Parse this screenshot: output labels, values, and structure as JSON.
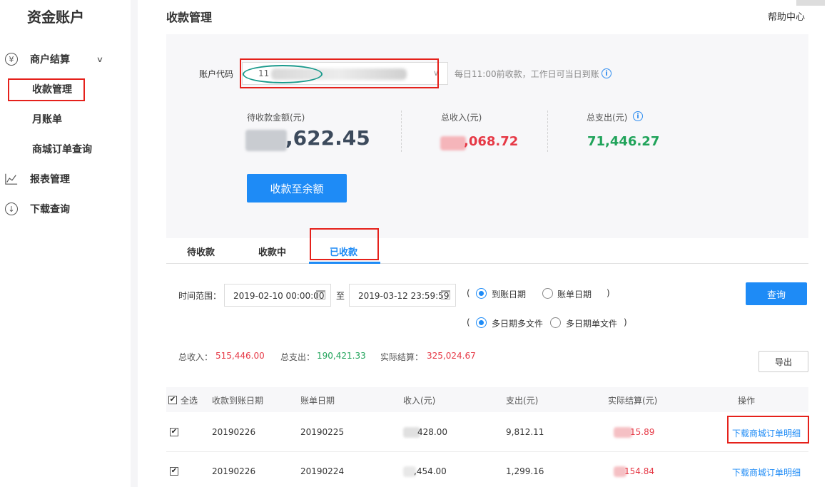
{
  "sidebar": {
    "brand": "资金账户",
    "groups": [
      {
        "label": "商户结算",
        "icon": "yen-circle-icon"
      },
      {
        "label": "报表管理",
        "icon": "chart-icon"
      },
      {
        "label": "下载查询",
        "icon": "download-circle-icon"
      }
    ],
    "items": [
      {
        "label": "收款管理"
      },
      {
        "label": "月账单"
      },
      {
        "label": "商城订单查询"
      }
    ]
  },
  "header": {
    "title": "收款管理",
    "help": "帮助中心"
  },
  "account": {
    "label": "账户代码",
    "value": "11",
    "note": "每日11:00前收款，工作日可当日到账"
  },
  "stats": {
    "pending_label": "待收款金额(元)",
    "pending_value": ",622.45",
    "income_label": "总收入(元)",
    "income_value": ",068.72",
    "expense_label": "总支出(元)",
    "expense_value": "71,446.27"
  },
  "collect_button": "收款至余额",
  "tabs": [
    {
      "label": "待收款"
    },
    {
      "label": "收款中"
    },
    {
      "label": "已收款"
    }
  ],
  "filters": {
    "time_range_label": "时间范围：",
    "start": "2019-02-10 00:00:00",
    "to": "至",
    "end": "2019-03-12 23:59:59",
    "open_paren": "(",
    "close_paren": ")",
    "date_type_options": [
      "到账日期",
      "账单日期"
    ],
    "file_mode_options": [
      "多日期多文件",
      "多日期单文件"
    ],
    "query_button": "查询"
  },
  "summary": {
    "income_label": "总收入：",
    "income_value": "515,446.00",
    "expense_label": "总支出：",
    "expense_value": "190,421.33",
    "net_label": "实际结算：",
    "net_value": "325,024.67",
    "export_button": "导出"
  },
  "table": {
    "select_all": "全选",
    "columns": [
      "收款到账日期",
      "账单日期",
      "收入(元)",
      "支出(元)",
      "实际结算(元)",
      "操作"
    ],
    "rows": [
      {
        "arrival_date": "20190226",
        "bill_date": "20190225",
        "income": "428.00",
        "expense": "9,812.11",
        "net": "15.89",
        "action": "下载商城订单明细"
      },
      {
        "arrival_date": "20190226",
        "bill_date": "20190224",
        "income": ",454.00",
        "expense": "1,299.16",
        "net": "154.84",
        "action": "下载商城订单明细"
      }
    ]
  },
  "colors": {
    "accent": "#1e8bf6",
    "red": "#e63946",
    "green": "#20a35a",
    "annotation_red": "#e5211b",
    "annotation_teal": "#1a9a8c"
  }
}
